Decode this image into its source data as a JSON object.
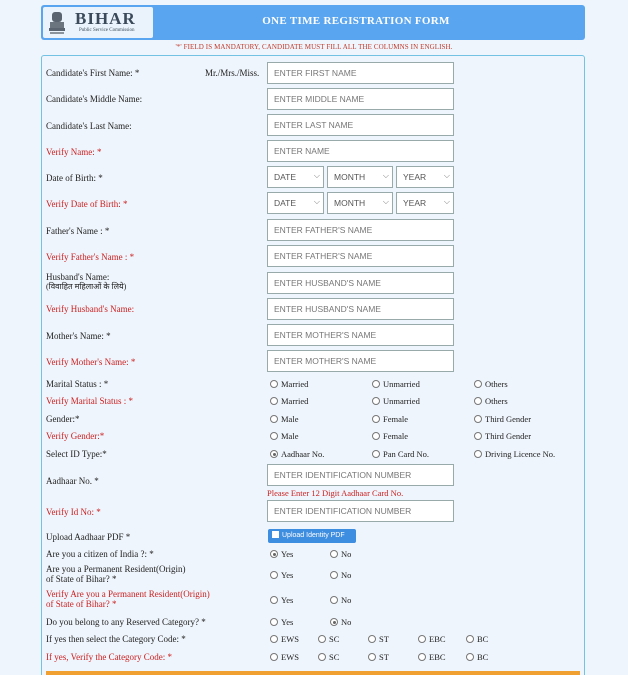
{
  "header": {
    "brand": "BIHAR",
    "brand_sub": "Public Service Commission",
    "title": "ONE TIME REGISTRATION FORM"
  },
  "notice": "'*' FIELD IS MANDATORY, CANDIDATE MUST FILL ALL THE COLUMNS IN ENGLISH.",
  "fields": {
    "first_name": {
      "label": "Candidate's First Name: *",
      "prefix": "Mr./Mrs./Miss.",
      "placeholder": "ENTER FIRST NAME"
    },
    "middle_name": {
      "label": "Candidate's Middle Name:",
      "placeholder": "ENTER MIDDLE NAME"
    },
    "last_name": {
      "label": "Candidate's Last Name:",
      "placeholder": "ENTER LAST NAME"
    },
    "verify_name": {
      "label": "Verify Name: *",
      "placeholder": "ENTER NAME"
    },
    "dob": {
      "label": "Date of Birth: *",
      "date": "DATE",
      "month": "MONTH",
      "year": "YEAR"
    },
    "verify_dob": {
      "label": "Verify Date of Birth: *",
      "date": "DATE",
      "month": "MONTH",
      "year": "YEAR"
    },
    "father": {
      "label": "Father's Name : *",
      "placeholder": "ENTER FATHER'S NAME"
    },
    "verify_father": {
      "label": "Verify Father's Name : *",
      "placeholder": "ENTER FATHER'S NAME"
    },
    "husband": {
      "label": "Husband's Name:",
      "note": "(विवाहित महिलाओं के लिये)",
      "placeholder": "ENTER HUSBAND'S NAME"
    },
    "verify_husband": {
      "label": "Verify Husband's Name:",
      "placeholder": "ENTER HUSBAND'S NAME"
    },
    "mother": {
      "label": "Mother's Name: *",
      "placeholder": "ENTER MOTHER'S NAME"
    },
    "verify_mother": {
      "label": "Verify Mother's Name: *",
      "placeholder": "ENTER MOTHER'S NAME"
    },
    "aadhaar": {
      "label": "Aadhaar No. *",
      "placeholder": "ENTER IDENTIFICATION NUMBER",
      "error": "Please Enter 12 Digit Aadhaar Card No."
    },
    "verify_id": {
      "label": "Verify Id No: *",
      "placeholder": "ENTER IDENTIFICATION NUMBER"
    },
    "upload": {
      "label": "Upload Aadhaar PDF *",
      "button": "Upload Identity PDF"
    }
  },
  "radios": {
    "marital": {
      "label": "Marital Status : *",
      "options": [
        "Married",
        "Unmarried",
        "Others"
      ]
    },
    "verify_marital": {
      "label": "Verify Marital Status : *",
      "options": [
        "Married",
        "Unmarried",
        "Others"
      ]
    },
    "gender": {
      "label": "Gender:*",
      "options": [
        "Male",
        "Female",
        "Third Gender"
      ]
    },
    "verify_gender": {
      "label": "Verify Gender:*",
      "options": [
        "Male",
        "Female",
        "Third Gender"
      ]
    },
    "id_type": {
      "label": "Select ID Type:*",
      "options": [
        "Aadhaar No.",
        "Pan Card No.",
        "Driving Licence No."
      ],
      "selected": "Aadhaar No."
    },
    "citizen": {
      "label": "Are you a citizen of India ?: *",
      "options": [
        "Yes",
        "No"
      ],
      "selected": "Yes"
    },
    "resident": {
      "label1": "Are you a Permanent Resident(Origin)",
      "label2": "of State of Bihar? *",
      "options": [
        "Yes",
        "No"
      ]
    },
    "verify_resident": {
      "label1": "Verify Are you a Permanent Resident(Origin)",
      "label2": "of State of Bihar? *",
      "options": [
        "Yes",
        "No"
      ]
    },
    "reserved": {
      "label": "Do you belong to any Reserved Category? *",
      "options": [
        "Yes",
        "No"
      ],
      "selected": "No"
    },
    "category": {
      "label": "If yes then select the Category Code: *",
      "options": [
        "EWS",
        "SC",
        "ST",
        "EBC",
        "BC"
      ]
    },
    "verify_category": {
      "label": "If yes, Verify the Category Code: *",
      "options": [
        "EWS",
        "SC",
        "ST",
        "EBC",
        "BC"
      ]
    }
  },
  "colors": {
    "header_bg": "#5aa5ef",
    "required_red": "#cc1f1f",
    "panel_border": "#73c1e3",
    "footer_orange": "#f0a030"
  }
}
